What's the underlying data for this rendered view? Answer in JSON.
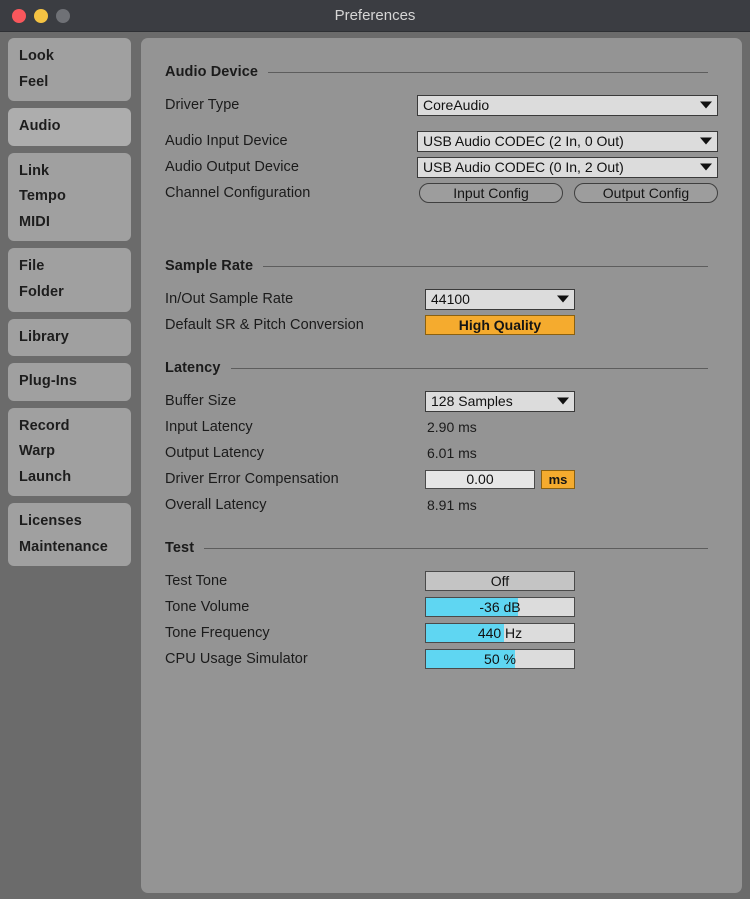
{
  "window": {
    "title": "Preferences",
    "traffic_lights": [
      {
        "name": "close",
        "color": "#f9575c"
      },
      {
        "name": "minimize",
        "color": "#f5c343"
      },
      {
        "name": "zoom",
        "color": "#6f7176"
      }
    ]
  },
  "sidebar": {
    "groups": [
      {
        "selected": false,
        "items": [
          "Look",
          "Feel"
        ]
      },
      {
        "selected": true,
        "items": [
          "Audio"
        ]
      },
      {
        "selected": false,
        "items": [
          "Link",
          "Tempo",
          "MIDI"
        ]
      },
      {
        "selected": false,
        "items": [
          "File",
          "Folder"
        ]
      },
      {
        "selected": false,
        "items": [
          "Library"
        ]
      },
      {
        "selected": false,
        "items": [
          "Plug-Ins"
        ]
      },
      {
        "selected": false,
        "items": [
          "Record",
          "Warp",
          "Launch"
        ]
      },
      {
        "selected": false,
        "items": [
          "Licenses",
          "Maintenance"
        ]
      }
    ]
  },
  "sections": {
    "audio_device": {
      "title": "Audio Device",
      "driver_type": {
        "label": "Driver Type",
        "value": "CoreAudio"
      },
      "audio_input_device": {
        "label": "Audio Input Device",
        "value": "USB Audio CODEC  (2 In, 0 Out)"
      },
      "audio_output_device": {
        "label": "Audio Output Device",
        "value": "USB Audio CODEC  (0 In, 2 Out)"
      },
      "channel_configuration": {
        "label": "Channel Configuration",
        "input_config": "Input Config",
        "output_config": "Output Config"
      }
    },
    "sample_rate": {
      "title": "Sample Rate",
      "in_out_sample_rate": {
        "label": "In/Out Sample Rate",
        "value": "44100"
      },
      "default_sr_pitch_conversion": {
        "label": "Default SR & Pitch Conversion",
        "value": "High Quality"
      }
    },
    "latency": {
      "title": "Latency",
      "buffer_size": {
        "label": "Buffer Size",
        "value": "128 Samples"
      },
      "input_latency": {
        "label": "Input Latency",
        "value": "2.90 ms"
      },
      "output_latency": {
        "label": "Output Latency",
        "value": "6.01 ms"
      },
      "driver_error_compensation": {
        "label": "Driver Error Compensation",
        "value": "0.00",
        "unit": "ms"
      },
      "overall_latency": {
        "label": "Overall Latency",
        "value": "8.91 ms"
      }
    },
    "test": {
      "title": "Test",
      "test_tone": {
        "label": "Test Tone",
        "value": "Off",
        "fill_percent": 0
      },
      "tone_volume": {
        "label": "Tone Volume",
        "value": "-36 dB",
        "fill_percent": 62
      },
      "tone_frequency": {
        "label": "Tone Frequency",
        "value": "440 Hz",
        "fill_percent": 53
      },
      "cpu_usage_simulator": {
        "label": "CPU Usage Simulator",
        "value": "50 %",
        "fill_percent": 60
      }
    }
  },
  "colors": {
    "accent_orange": "#f5ab2e",
    "slider_cyan": "#5fd6f2",
    "panel_bg": "#949494",
    "window_bg": "#6b6b6b",
    "titlebar_bg": "#3b3d42"
  }
}
